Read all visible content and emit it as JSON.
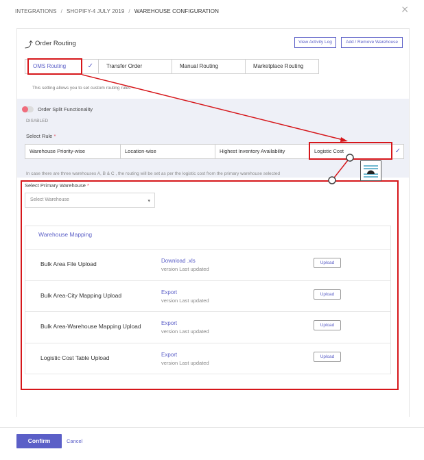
{
  "breadcrumb": {
    "items": [
      "INTEGRATIONS",
      "SHOPIFY-4 JULY 2019",
      "WAREHOUSE CONFIGURATION"
    ],
    "separator": "/"
  },
  "close_glyph": "×",
  "header": {
    "title": "Order Routing",
    "icon": "routing-arrow-icon",
    "icon_glyph": "⤴",
    "view_log_label": "View Activity Log",
    "add_remove_label": "Add / Remove Warehouse"
  },
  "tabs": [
    {
      "label": "OMS Routing",
      "active": true
    },
    {
      "label": "Transfer Order",
      "active": false
    },
    {
      "label": "Manual Routing",
      "active": false
    },
    {
      "label": "Marketplace Routing",
      "active": false
    }
  ],
  "check_glyph": "✓",
  "tab_description": "This setting allows you to set custom routing rules",
  "split": {
    "label": "Order Split Functionality",
    "status": "DISABLED",
    "enabled": false
  },
  "select_rule": {
    "label": "Select Rule",
    "required_mark": "*",
    "options": [
      {
        "label": "Warehouse Priority-wise",
        "selected": false
      },
      {
        "label": "Location-wise",
        "selected": false
      },
      {
        "label": "Highest Inventory Availability",
        "selected": false
      },
      {
        "label": "Logistic Cost",
        "selected": true
      }
    ],
    "note": "In case there are three warehouses A, B & C , the routing will be set as per the logistic cost from the primary warehouse selected"
  },
  "primary_warehouse": {
    "label": "Select Primary Warehouse",
    "required_mark": "*",
    "placeholder": "Select Warehouse",
    "caret_glyph": "▾"
  },
  "warehouse_mapping": {
    "title": "Warehouse Mapping",
    "rows": [
      {
        "label": "Bulk Area File Upload",
        "link": "Download .xls",
        "version": "version Last updated",
        "button": "Upload"
      },
      {
        "label": "Bulk Area-City Mapping Upload",
        "link": "Export",
        "version": "version Last updated",
        "button": "Upload"
      },
      {
        "label": "Bulk Area-Warehouse Mapping Upload",
        "link": "Export",
        "version": "version Last updated",
        "button": "Upload"
      },
      {
        "label": "Logistic Cost Table Upload",
        "link": "Export",
        "version": "version Last updated",
        "button": "Upload"
      }
    ]
  },
  "footer": {
    "confirm_label": "Confirm",
    "cancel_label": "Cancel"
  },
  "colors": {
    "accent": "#5b5fc7",
    "annotation": "#d6161a",
    "toggle_off": "#f06d7d",
    "band": "#eef0f7"
  }
}
